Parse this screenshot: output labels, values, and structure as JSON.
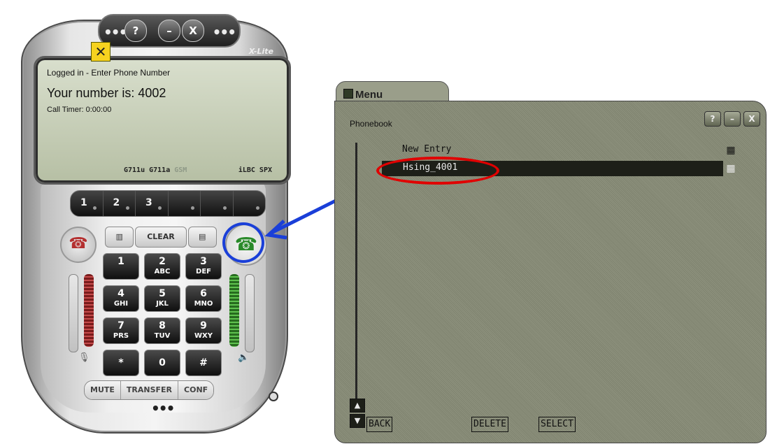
{
  "phone": {
    "brand": "X-Lite",
    "window_buttons": {
      "help": "?",
      "minimize": "–",
      "close": "X"
    },
    "dots": "•••",
    "screen": {
      "status": "Logged in - Enter Phone Number",
      "number_line": "Your number is: 4002",
      "timer": "Call Timer: 0:00:00",
      "codecs": [
        "G711u",
        "G711a",
        "GSM"
      ],
      "codec_dim": "GSM",
      "codecs_right": "iLBC SPX"
    },
    "lines": [
      "1",
      "2",
      "3",
      "",
      "",
      ""
    ],
    "controls": {
      "clear": "CLEAR"
    },
    "keypad": [
      {
        "digit": "1",
        "letters": ""
      },
      {
        "digit": "2",
        "letters": "ABC"
      },
      {
        "digit": "3",
        "letters": "DEF"
      },
      {
        "digit": "4",
        "letters": "GHI"
      },
      {
        "digit": "5",
        "letters": "JKL"
      },
      {
        "digit": "6",
        "letters": "MNO"
      },
      {
        "digit": "7",
        "letters": "PRS"
      },
      {
        "digit": "8",
        "letters": "TUV"
      },
      {
        "digit": "9",
        "letters": "WXY"
      },
      {
        "digit": "*",
        "letters": ""
      },
      {
        "digit": "0",
        "letters": ""
      },
      {
        "digit": "#",
        "letters": ""
      }
    ],
    "bottom": {
      "mute": "MUTE",
      "transfer": "TRANSFER",
      "conf": "CONF"
    },
    "colors": {
      "dial_green": "#2a8a2a",
      "hangup_red": "#b43030",
      "annotation_blue": "#1a3fd8"
    }
  },
  "menu": {
    "title": "Menu",
    "section": "Phonebook",
    "window_buttons": {
      "help": "?",
      "minimize": "–",
      "close": "X"
    },
    "entries": [
      {
        "name": "New Entry",
        "selected": false
      },
      {
        "name": "Hsing_4001",
        "selected": true
      }
    ],
    "actions": {
      "back": "BACK",
      "delete": "DELETE",
      "select": "SELECT"
    },
    "colors": {
      "annotation_red": "#e00000"
    }
  }
}
